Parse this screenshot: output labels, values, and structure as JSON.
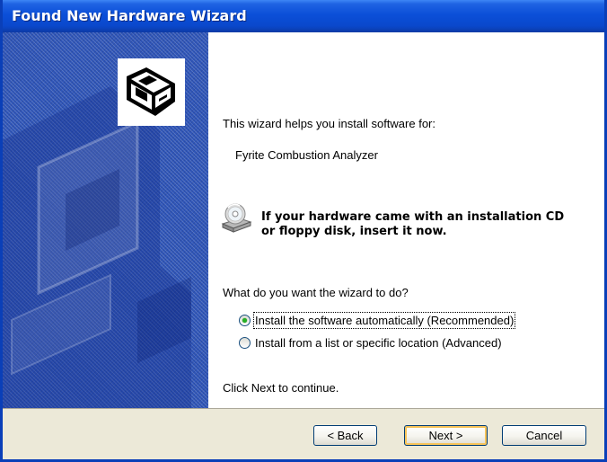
{
  "window": {
    "title": "Found New Hardware Wizard"
  },
  "content": {
    "intro": "This wizard helps you install software for:",
    "device_name": "Fyrite Combustion Analyzer",
    "cd_prompt_line1": "If your hardware came with an installation CD",
    "cd_prompt_line2": "or floppy disk, insert it now.",
    "question": "What do you want the wizard to do?",
    "options": [
      {
        "label": "Install the software automatically (Recommended)",
        "selected": true
      },
      {
        "label": "Install from a list or specific location (Advanced)",
        "selected": false
      }
    ],
    "continue_hint": "Click Next to continue."
  },
  "buttons": {
    "back": "< Back",
    "next": "Next >",
    "cancel": "Cancel"
  },
  "icons": {
    "side": "hardware-wizard-icon",
    "cd": "cd-drive-icon"
  },
  "colors": {
    "titlebar": "#0a4fd8",
    "side_panel": "#2f55b8",
    "footer": "#ece9d8",
    "radio_dot": "#25b125"
  }
}
